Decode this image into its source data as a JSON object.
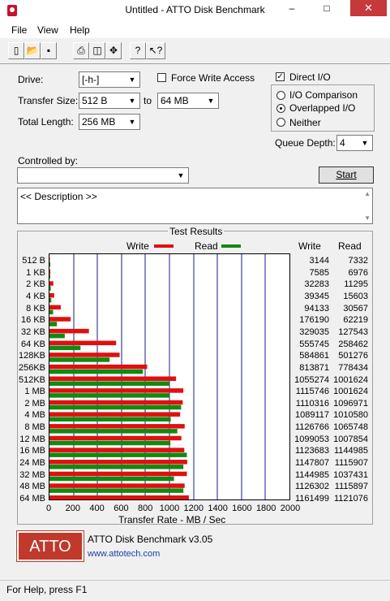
{
  "window": {
    "title": "Untitled - ATTO Disk Benchmark",
    "minimize": "–",
    "maximize": "□",
    "close": "✕"
  },
  "menu": [
    "File",
    "View",
    "Help"
  ],
  "toolbar": {
    "icons": [
      "new-icon",
      "open-icon",
      "save-icon",
      "print-icon",
      "print-preview-icon",
      "move-icon",
      "help-icon",
      "context-help-icon"
    ]
  },
  "form": {
    "drive_label": "Drive:",
    "drive_value": "[-h-]",
    "force_write_label": "Force Write Access",
    "force_write_checked": false,
    "direct_io_label": "Direct I/O",
    "direct_io_checked": true,
    "transfer_size_label": "Transfer Size:",
    "transfer_from": "512 B",
    "to_label": "to",
    "transfer_to": "64 MB",
    "total_length_label": "Total Length:",
    "total_length_value": "256 MB",
    "io_options": [
      {
        "label": "I/O Comparison",
        "selected": false
      },
      {
        "label": "Overlapped I/O",
        "selected": true
      },
      {
        "label": "Neither",
        "selected": false
      }
    ],
    "queue_depth_label": "Queue Depth:",
    "queue_depth_value": "4",
    "controlled_by_label": "Controlled by:",
    "controlled_by_value": "",
    "start_label": "Start",
    "description": "<< Description >>"
  },
  "results": {
    "title": "Test Results",
    "write_col": "Write",
    "read_col": "Read",
    "legend_write": "Write",
    "legend_read": "Read"
  },
  "chart_data": {
    "type": "bar",
    "orientation": "horizontal",
    "categories": [
      "512 B",
      "1 KB",
      "2 KB",
      "4 KB",
      "8 KB",
      "16 KB",
      "32 KB",
      "64 KB",
      "128KB",
      "256KB",
      "512KB",
      "1 MB",
      "2 MB",
      "4 MB",
      "8 MB",
      "12 MB",
      "16 MB",
      "24 MB",
      "32 MB",
      "48 MB",
      "64 MB"
    ],
    "series": [
      {
        "name": "Write",
        "color": "#e01010",
        "values": [
          3144,
          7585,
          32283,
          39345,
          94133,
          176190,
          329035,
          555745,
          584861,
          813871,
          1055274,
          1115746,
          1110316,
          1089117,
          1126766,
          1099053,
          1123683,
          1147807,
          1144985,
          1126302,
          1161499
        ]
      },
      {
        "name": "Read",
        "color": "#108a10",
        "values": [
          7332,
          6976,
          11295,
          15603,
          30567,
          62219,
          127543,
          258462,
          501276,
          778434,
          1001624,
          1001624,
          1096971,
          1010580,
          1065748,
          1007854,
          1144985,
          1115907,
          1037431,
          1115897,
          1121076
        ]
      }
    ],
    "xlabel": "Transfer Rate - MB / Sec",
    "xlim": [
      0,
      2000
    ],
    "xticks": [
      "0",
      "200",
      "400",
      "600",
      "800",
      "1000",
      "1200",
      "1400",
      "1600",
      "1800",
      "2000"
    ],
    "grid": true,
    "legend": "top"
  },
  "footer": {
    "logo_text": "ATTO",
    "product": "ATTO Disk Benchmark v3.05",
    "url": "www.attotech.com"
  },
  "status": "For Help, press F1"
}
